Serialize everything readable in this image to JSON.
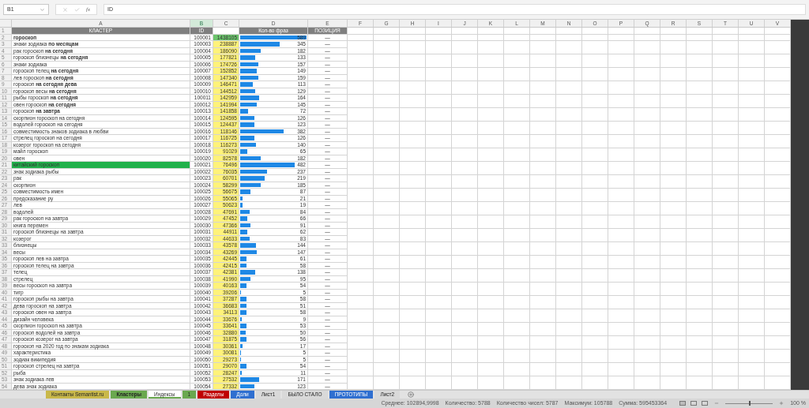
{
  "formula_bar": {
    "name_box": "B1",
    "function_label": "fx",
    "formula": "ID"
  },
  "columns": [
    {
      "label": "A",
      "selected": false
    },
    {
      "label": "B",
      "selected": true
    },
    {
      "label": "C",
      "selected": false
    },
    {
      "label": "D",
      "selected": false
    },
    {
      "label": "E",
      "selected": false
    },
    {
      "label": "F",
      "selected": false
    },
    {
      "label": "G",
      "selected": false
    },
    {
      "label": "H",
      "selected": false
    },
    {
      "label": "I",
      "selected": false
    },
    {
      "label": "J",
      "selected": false
    },
    {
      "label": "K",
      "selected": false
    },
    {
      "label": "L",
      "selected": false
    },
    {
      "label": "M",
      "selected": false
    },
    {
      "label": "N",
      "selected": false
    },
    {
      "label": "O",
      "selected": false
    },
    {
      "label": "P",
      "selected": false
    },
    {
      "label": "Q",
      "selected": false
    },
    {
      "label": "R",
      "selected": false
    },
    {
      "label": "S",
      "selected": false
    },
    {
      "label": "T",
      "selected": false
    },
    {
      "label": "U",
      "selected": false
    },
    {
      "label": "V",
      "selected": false
    }
  ],
  "header_row": {
    "number": "1",
    "cluster": "КЛАСТЕР",
    "id": "ID",
    "count": "Кол-во фраз",
    "position": "ПОЗИЦИЯ"
  },
  "rows": [
    {
      "number": "2",
      "cluster": "гороскоп",
      "bold": true,
      "cluster_highlighted": false,
      "id": "100001",
      "volume": "1438105",
      "volume_highlighted": true,
      "count": "589",
      "level": 1,
      "position": "—"
    },
    {
      "number": "3",
      "cluster": "знаки зодиака **по месяцам**",
      "bold": false,
      "cluster_highlighted": false,
      "id": "100003",
      "volume": "238887",
      "volume_highlighted": false,
      "count": "345",
      "level": 0.59,
      "position": "—"
    },
    {
      "number": "4",
      "cluster": "рак гороскоп **на сегодня**",
      "bold": false,
      "cluster_highlighted": false,
      "id": "100004",
      "volume": "186090",
      "volume_highlighted": false,
      "count": "182",
      "level": 0.31,
      "position": "—"
    },
    {
      "number": "5",
      "cluster": "гороскоп близнецы **на сегодня**",
      "bold": false,
      "cluster_highlighted": false,
      "id": "100005",
      "volume": "177821",
      "volume_highlighted": false,
      "count": "133",
      "level": 0.23,
      "position": "—"
    },
    {
      "number": "6",
      "cluster": "знаки зодиака",
      "bold": false,
      "cluster_highlighted": false,
      "id": "100006",
      "volume": "174726",
      "volume_highlighted": false,
      "count": "157",
      "level": 0.27,
      "position": "—"
    },
    {
      "number": "7",
      "cluster": "гороскоп телец **на сегодня**",
      "bold": false,
      "cluster_highlighted": false,
      "id": "100007",
      "volume": "152852",
      "volume_highlighted": false,
      "count": "149",
      "level": 0.25,
      "position": "—"
    },
    {
      "number": "8",
      "cluster": "лев гороскоп **на сегодня**",
      "bold": false,
      "cluster_highlighted": false,
      "id": "100008",
      "volume": "147340",
      "volume_highlighted": false,
      "count": "159",
      "level": 0.27,
      "position": "—"
    },
    {
      "number": "9",
      "cluster": "гороскоп **на сегодня дева**",
      "bold": false,
      "cluster_highlighted": false,
      "id": "100009",
      "volume": "146471",
      "volume_highlighted": false,
      "count": "113",
      "level": 0.19,
      "position": "—"
    },
    {
      "number": "10",
      "cluster": "гороскоп весы **на сегодня**",
      "bold": false,
      "cluster_highlighted": false,
      "id": "100010",
      "volume": "144512",
      "volume_highlighted": false,
      "count": "129",
      "level": 0.22,
      "position": "—"
    },
    {
      "number": "11",
      "cluster": "рыбы гороскоп **на сегодня**",
      "bold": false,
      "cluster_highlighted": false,
      "id": "100011",
      "volume": "142959",
      "volume_highlighted": false,
      "count": "164",
      "level": 0.28,
      "position": "—"
    },
    {
      "number": "12",
      "cluster": "овен гороскоп **на сегодня**",
      "bold": false,
      "cluster_highlighted": false,
      "id": "100012",
      "volume": "141994",
      "volume_highlighted": false,
      "count": "145",
      "level": 0.25,
      "position": "—"
    },
    {
      "number": "13",
      "cluster": "гороскоп **на завтра**",
      "bold": false,
      "cluster_highlighted": false,
      "id": "100013",
      "volume": "141858",
      "volume_highlighted": false,
      "count": "72",
      "level": 0.12,
      "position": "—"
    },
    {
      "number": "14",
      "cluster": "скорпион гороскоп на сегодня",
      "bold": false,
      "cluster_highlighted": false,
      "id": "100014",
      "volume": "124595",
      "volume_highlighted": false,
      "count": "126",
      "level": 0.21,
      "position": "—"
    },
    {
      "number": "15",
      "cluster": "водолей гороскоп на сегодня",
      "bold": false,
      "cluster_highlighted": false,
      "id": "100015",
      "volume": "124437",
      "volume_highlighted": false,
      "count": "123",
      "level": 0.21,
      "position": "—"
    },
    {
      "number": "16",
      "cluster": "совместимость знаков зодиака в любви",
      "bold": false,
      "cluster_highlighted": false,
      "id": "100016",
      "volume": "118146",
      "volume_highlighted": false,
      "count": "382",
      "level": 0.65,
      "position": "—"
    },
    {
      "number": "17",
      "cluster": "стрелец гороскоп на сегодня",
      "bold": false,
      "cluster_highlighted": false,
      "id": "100017",
      "volume": "116725",
      "volume_highlighted": false,
      "count": "126",
      "level": 0.21,
      "position": "—"
    },
    {
      "number": "18",
      "cluster": "козерог гороскоп на сегодня",
      "bold": false,
      "cluster_highlighted": false,
      "id": "100018",
      "volume": "116273",
      "volume_highlighted": false,
      "count": "140",
      "level": 0.24,
      "position": "—"
    },
    {
      "number": "19",
      "cluster": "майл гороскоп",
      "bold": false,
      "cluster_highlighted": false,
      "id": "100019",
      "volume": "91029",
      "volume_highlighted": false,
      "count": "65",
      "level": 0.11,
      "position": "—"
    },
    {
      "number": "20",
      "cluster": "овен",
      "bold": false,
      "cluster_highlighted": false,
      "id": "100020",
      "volume": "82578",
      "volume_highlighted": false,
      "count": "182",
      "level": 0.31,
      "position": "—"
    },
    {
      "number": "21",
      "cluster": "китайский гороскоп",
      "bold": false,
      "cluster_highlighted": true,
      "id": "100021",
      "volume": "76496",
      "volume_highlighted": false,
      "count": "482",
      "level": 0.82,
      "position": "—"
    },
    {
      "number": "22",
      "cluster": "знак зодиака рыбы",
      "bold": false,
      "cluster_highlighted": false,
      "id": "100022",
      "volume": "76035",
      "volume_highlighted": false,
      "count": "237",
      "level": 0.4,
      "position": "—"
    },
    {
      "number": "23",
      "cluster": "рак",
      "bold": false,
      "cluster_highlighted": false,
      "id": "100023",
      "volume": "60701",
      "volume_highlighted": false,
      "count": "219",
      "level": 0.37,
      "position": "—"
    },
    {
      "number": "24",
      "cluster": "скорпион",
      "bold": false,
      "cluster_highlighted": false,
      "id": "100024",
      "volume": "58299",
      "volume_highlighted": false,
      "count": "185",
      "level": 0.31,
      "position": "—"
    },
    {
      "number": "25",
      "cluster": "совместимость имен",
      "bold": false,
      "cluster_highlighted": false,
      "id": "100025",
      "volume": "56675",
      "volume_highlighted": false,
      "count": "87",
      "level": 0.15,
      "position": "—"
    },
    {
      "number": "26",
      "cluster": "предсказание ру",
      "bold": false,
      "cluster_highlighted": false,
      "id": "100026",
      "volume": "55065",
      "volume_highlighted": false,
      "count": "21",
      "level": 0.04,
      "position": "—"
    },
    {
      "number": "27",
      "cluster": "лев",
      "bold": false,
      "cluster_highlighted": false,
      "id": "100027",
      "volume": "50623",
      "volume_highlighted": false,
      "count": "19",
      "level": 0.03,
      "position": "—"
    },
    {
      "number": "28",
      "cluster": "водолей",
      "bold": false,
      "cluster_highlighted": false,
      "id": "100028",
      "volume": "47691",
      "volume_highlighted": false,
      "count": "84",
      "level": 0.14,
      "position": "—"
    },
    {
      "number": "29",
      "cluster": "рак гороскоп на завтра",
      "bold": false,
      "cluster_highlighted": false,
      "id": "100029",
      "volume": "47452",
      "volume_highlighted": false,
      "count": "66",
      "level": 0.11,
      "position": "—"
    },
    {
      "number": "30",
      "cluster": "книга перемен",
      "bold": false,
      "cluster_highlighted": false,
      "id": "100030",
      "volume": "47366",
      "volume_highlighted": false,
      "count": "91",
      "level": 0.15,
      "position": "—"
    },
    {
      "number": "31",
      "cluster": "гороскоп близнецы на завтра",
      "bold": false,
      "cluster_highlighted": false,
      "id": "100031",
      "volume": "44911",
      "volume_highlighted": false,
      "count": "62",
      "level": 0.11,
      "position": "—"
    },
    {
      "number": "32",
      "cluster": "козерог",
      "bold": false,
      "cluster_highlighted": false,
      "id": "100032",
      "volume": "44633",
      "volume_highlighted": false,
      "count": "83",
      "level": 0.14,
      "position": "—"
    },
    {
      "number": "33",
      "cluster": "близнецы",
      "bold": false,
      "cluster_highlighted": false,
      "id": "100033",
      "volume": "43578",
      "volume_highlighted": false,
      "count": "144",
      "level": 0.24,
      "position": "—"
    },
    {
      "number": "34",
      "cluster": "весы",
      "bold": false,
      "cluster_highlighted": false,
      "id": "100034",
      "volume": "43269",
      "volume_highlighted": false,
      "count": "147",
      "level": 0.25,
      "position": "—"
    },
    {
      "number": "35",
      "cluster": "гороскоп лев на завтра",
      "bold": false,
      "cluster_highlighted": false,
      "id": "100035",
      "volume": "42445",
      "volume_highlighted": false,
      "count": "61",
      "level": 0.1,
      "position": "—"
    },
    {
      "number": "36",
      "cluster": "гороскоп телец на завтра",
      "bold": false,
      "cluster_highlighted": false,
      "id": "100036",
      "volume": "42415",
      "volume_highlighted": false,
      "count": "58",
      "level": 0.1,
      "position": "—"
    },
    {
      "number": "37",
      "cluster": "телец",
      "bold": false,
      "cluster_highlighted": false,
      "id": "100037",
      "volume": "42381",
      "volume_highlighted": false,
      "count": "138",
      "level": 0.23,
      "position": "—"
    },
    {
      "number": "38",
      "cluster": "стрелец",
      "bold": false,
      "cluster_highlighted": false,
      "id": "100038",
      "volume": "41990",
      "volume_highlighted": false,
      "count": "95",
      "level": 0.16,
      "position": "—"
    },
    {
      "number": "39",
      "cluster": "весы гороскоп на завтра",
      "bold": false,
      "cluster_highlighted": false,
      "id": "100039",
      "volume": "40163",
      "volume_highlighted": false,
      "count": "54",
      "level": 0.09,
      "position": "—"
    },
    {
      "number": "40",
      "cluster": "тигр",
      "bold": false,
      "cluster_highlighted": false,
      "id": "100040",
      "volume": "39206",
      "volume_highlighted": false,
      "count": "5",
      "level": 0.01,
      "position": "—"
    },
    {
      "number": "41",
      "cluster": "гороскоп рыбы на завтра",
      "bold": false,
      "cluster_highlighted": false,
      "id": "100041",
      "volume": "37287",
      "volume_highlighted": false,
      "count": "58",
      "level": 0.1,
      "position": "—"
    },
    {
      "number": "42",
      "cluster": "дева гороскоп на завтра",
      "bold": false,
      "cluster_highlighted": false,
      "id": "100042",
      "volume": "36683",
      "volume_highlighted": false,
      "count": "51",
      "level": 0.09,
      "position": "—"
    },
    {
      "number": "43",
      "cluster": "гороскоп овен на завтра",
      "bold": false,
      "cluster_highlighted": false,
      "id": "100043",
      "volume": "34113",
      "volume_highlighted": false,
      "count": "58",
      "level": 0.1,
      "position": "—"
    },
    {
      "number": "44",
      "cluster": "дизайн человека",
      "bold": false,
      "cluster_highlighted": false,
      "id": "100044",
      "volume": "33676",
      "volume_highlighted": false,
      "count": "9",
      "level": 0.02,
      "position": "—"
    },
    {
      "number": "45",
      "cluster": "скорпион гороскоп на завтра",
      "bold": false,
      "cluster_highlighted": false,
      "id": "100045",
      "volume": "33641",
      "volume_highlighted": false,
      "count": "53",
      "level": 0.09,
      "position": "—"
    },
    {
      "number": "46",
      "cluster": "гороскоп водолей на завтра",
      "bold": false,
      "cluster_highlighted": false,
      "id": "100046",
      "volume": "32880",
      "volume_highlighted": false,
      "count": "50",
      "level": 0.08,
      "position": "—"
    },
    {
      "number": "47",
      "cluster": "гороскоп козерог на завтра",
      "bold": false,
      "cluster_highlighted": false,
      "id": "100047",
      "volume": "31875",
      "volume_highlighted": false,
      "count": "56",
      "level": 0.1,
      "position": "—"
    },
    {
      "number": "48",
      "cluster": "гороскоп на 2020 год по знакам зодиака",
      "bold": false,
      "cluster_highlighted": false,
      "id": "100048",
      "volume": "30361",
      "volume_highlighted": false,
      "count": "17",
      "level": 0.03,
      "position": "—"
    },
    {
      "number": "49",
      "cluster": "характеристика",
      "bold": false,
      "cluster_highlighted": false,
      "id": "100049",
      "volume": "30081",
      "volume_highlighted": false,
      "count": "5",
      "level": 0.01,
      "position": "—"
    },
    {
      "number": "50",
      "cluster": "зодиак википедия",
      "bold": false,
      "cluster_highlighted": false,
      "id": "100050",
      "volume": "29273",
      "volume_highlighted": false,
      "count": "5",
      "level": 0.01,
      "position": "—"
    },
    {
      "number": "51",
      "cluster": "гороскоп стрелец на завтра",
      "bold": false,
      "cluster_highlighted": false,
      "id": "100051",
      "volume": "29070",
      "volume_highlighted": false,
      "count": "54",
      "level": 0.09,
      "position": "—"
    },
    {
      "number": "52",
      "cluster": "рыба",
      "bold": false,
      "cluster_highlighted": false,
      "id": "100052",
      "volume": "28247",
      "volume_highlighted": false,
      "count": "11",
      "level": 0.02,
      "position": "—"
    },
    {
      "number": "53",
      "cluster": "знак зодиака лев",
      "bold": false,
      "cluster_highlighted": false,
      "id": "100053",
      "volume": "27532",
      "volume_highlighted": false,
      "count": "171",
      "level": 0.29,
      "position": "—"
    },
    {
      "number": "54",
      "cluster": "дева знак зодиака",
      "bold": false,
      "cluster_highlighted": false,
      "id": "100054",
      "volume": "27332",
      "volume_highlighted": false,
      "count": "123",
      "level": 0.21,
      "position": "—"
    }
  ],
  "sheet_tabs": [
    {
      "label": "Контакты Semantist.ru",
      "color": "#c9b84a",
      "selected": false,
      "bold": false
    },
    {
      "label": "Кластеры",
      "color": "#6aa84f",
      "selected": false,
      "bold": true
    },
    {
      "label": "Индексы",
      "color": "#6aa84f",
      "selected": true,
      "bold": false
    },
    {
      "label": "1",
      "color": "#6aa84f",
      "selected": false,
      "bold": false
    },
    {
      "label": "Разделы",
      "color": "#c00000",
      "selected": false,
      "bold": false
    },
    {
      "label": "Доли",
      "color": "#2f6fd0",
      "selected": false,
      "bold": false
    },
    {
      "label": "Лист1",
      "color": "#d9d9d9",
      "selected": false,
      "bold": false
    },
    {
      "label": "БЫЛО СТАЛО",
      "color": "#d9d9d9",
      "selected": false,
      "bold": false
    },
    {
      "label": "ПРОТОТИПЫ",
      "color": "#2f6fd0",
      "selected": false,
      "bold": false
    },
    {
      "label": "Лист2",
      "color": "#d9d9d9",
      "selected": false,
      "bold": false
    }
  ],
  "status_bar": {
    "stats": [
      "Среднее: 102894,9998",
      "Количество: 5788",
      "Количество чисел: 5787",
      "Максимум: 105788",
      "Сумма: 595453364"
    ],
    "zoom": {
      "level": 0.5,
      "reading": "100 %"
    }
  }
}
